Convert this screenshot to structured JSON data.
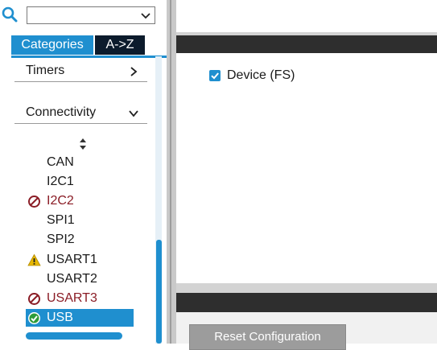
{
  "search": {
    "value": ""
  },
  "tabs": {
    "categories": "Categories",
    "az": "A->Z"
  },
  "sections": [
    {
      "label": "Timers",
      "expanded": false
    },
    {
      "label": "Connectivity",
      "expanded": true
    }
  ],
  "peripherals": [
    {
      "label": "CAN",
      "status": "none"
    },
    {
      "label": "I2C1",
      "status": "none"
    },
    {
      "label": "I2C2",
      "status": "disabled"
    },
    {
      "label": "SPI1",
      "status": "none"
    },
    {
      "label": "SPI2",
      "status": "none"
    },
    {
      "label": "USART1",
      "status": "warning"
    },
    {
      "label": "USART2",
      "status": "none"
    },
    {
      "label": "USART3",
      "status": "disabled"
    },
    {
      "label": "USB",
      "status": "ok",
      "selected": true
    }
  ],
  "mode": {
    "device_label": "Device (FS)",
    "device_checked": true
  },
  "config": {
    "reset_button": "Reset Configuration"
  },
  "colors": {
    "accent": "#1f8fcf",
    "dark_tab": "#0c1b2c",
    "disabled": "#8a1c25",
    "warning": "#e8b800",
    "bar": "#2e2e2e"
  }
}
